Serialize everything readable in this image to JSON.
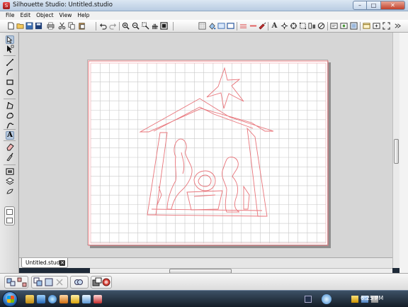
{
  "window": {
    "title": "Silhouette Studio: Untitled.studio",
    "app_icon_glyph": "S",
    "minimize_glyph": "–",
    "maximize_glyph": "□",
    "close_glyph": "✕"
  },
  "menu": {
    "items": [
      "File",
      "Edit",
      "Object",
      "View",
      "Help"
    ]
  },
  "toolbar": {
    "text_tool_glyph": "A",
    "icons": [
      "new-icon",
      "open-icon",
      "save-icon",
      "save-as-icon",
      "print-icon",
      "cut-icon",
      "copy-icon",
      "paste-icon",
      "undo-icon",
      "redo-icon",
      "zoom-in-icon",
      "zoom-out-icon",
      "zoom-select-icon",
      "pan-icon",
      "fit-to-page-icon",
      "grid-icon",
      "fill-icon",
      "line-color-icon",
      "line-style-icon",
      "cut-style-icon",
      "text-icon",
      "modify-icon",
      "replicate-icon",
      "transform-icon",
      "align-icon",
      "offset-icon",
      "knife-icon",
      "trace-icon",
      "page-settings-icon",
      "registration-icon",
      "library-icon",
      "fullscreen-icon"
    ]
  },
  "left_toolbar": {
    "text_tool_glyph": "A",
    "tools": [
      "select-icon",
      "point-edit-icon",
      "line-icon",
      "curve-icon",
      "arc-icon",
      "rectangle-icon",
      "ellipse-icon",
      "polygon-icon",
      "curvy-polygon-icon",
      "freehand-icon",
      "text-tool-icon",
      "eraser-icon",
      "knife-tool-icon"
    ]
  },
  "tabs": {
    "document": "Untitled.studio",
    "close_glyph": "✕"
  },
  "taskbar": {
    "time": "6:25 PM"
  },
  "colors": {
    "grid_minor": "#c9c9c9",
    "cut_line": "#e8747a",
    "page_border": "#e8747a",
    "workspace": "#d6d6d6"
  }
}
